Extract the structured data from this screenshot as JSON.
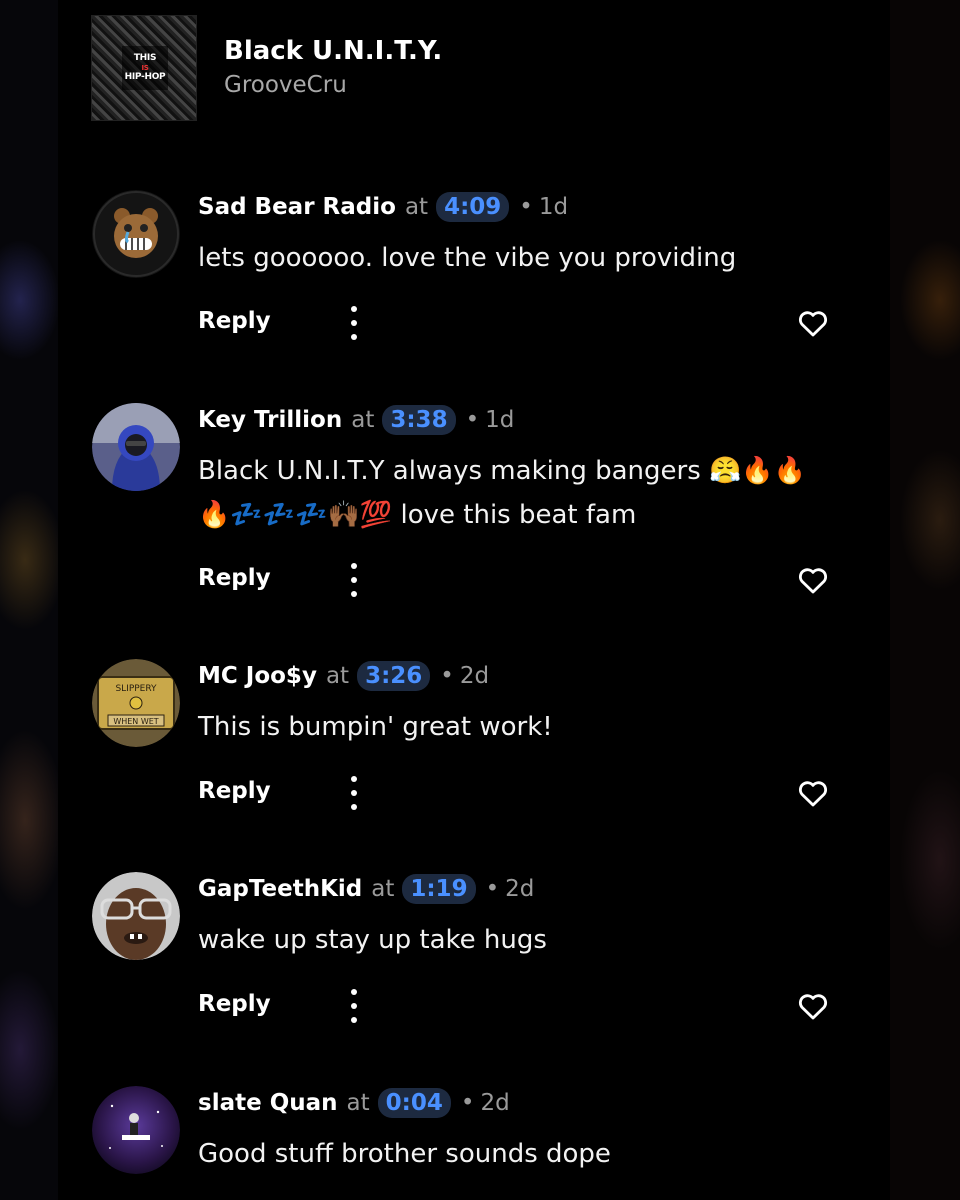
{
  "track": {
    "title": "Black U.N.I.T.Y.",
    "artist": "GrooveCru",
    "cover_text": [
      "THIS",
      "IS",
      "HIP-HOP"
    ]
  },
  "colors": {
    "background": "#000000",
    "timestamp_bg": "#1d2a40",
    "timestamp_text": "#4a90ff",
    "muted_text": "#9a9a9a"
  },
  "at_label": "at",
  "reply_label": "Reply",
  "comments": [
    {
      "user": "Sad Bear Radio",
      "time": "4:09",
      "age": "1d",
      "body": "lets goooooo. love the vibe you providing",
      "avatar_icon": "bear-face-avatar"
    },
    {
      "user": "Key Trillion",
      "time": "3:38",
      "age": "1d",
      "body": "Black U.N.I.T.Y always making bangers 😤🔥🔥🔥💤💤💤🙌🏾💯 love this beat fam",
      "avatar_icon": "person-hoodie-avatar"
    },
    {
      "user": "MC Joo$y",
      "time": "3:26",
      "age": "2d",
      "body": "This is bumpin' great work!",
      "avatar_icon": "slippery-when-wet-sign-avatar",
      "avatar_text": [
        "SLIPPERY",
        "WHEN WET"
      ]
    },
    {
      "user": "GapTeethKid",
      "time": "1:19",
      "age": "2d",
      "body": "wake up stay up take hugs",
      "avatar_icon": "face-with-glasses-avatar"
    },
    {
      "user": "slate Quan",
      "time": "0:04",
      "age": "2d",
      "body": "Good stuff brother sounds dope",
      "avatar_icon": "purple-galaxy-avatar"
    }
  ]
}
